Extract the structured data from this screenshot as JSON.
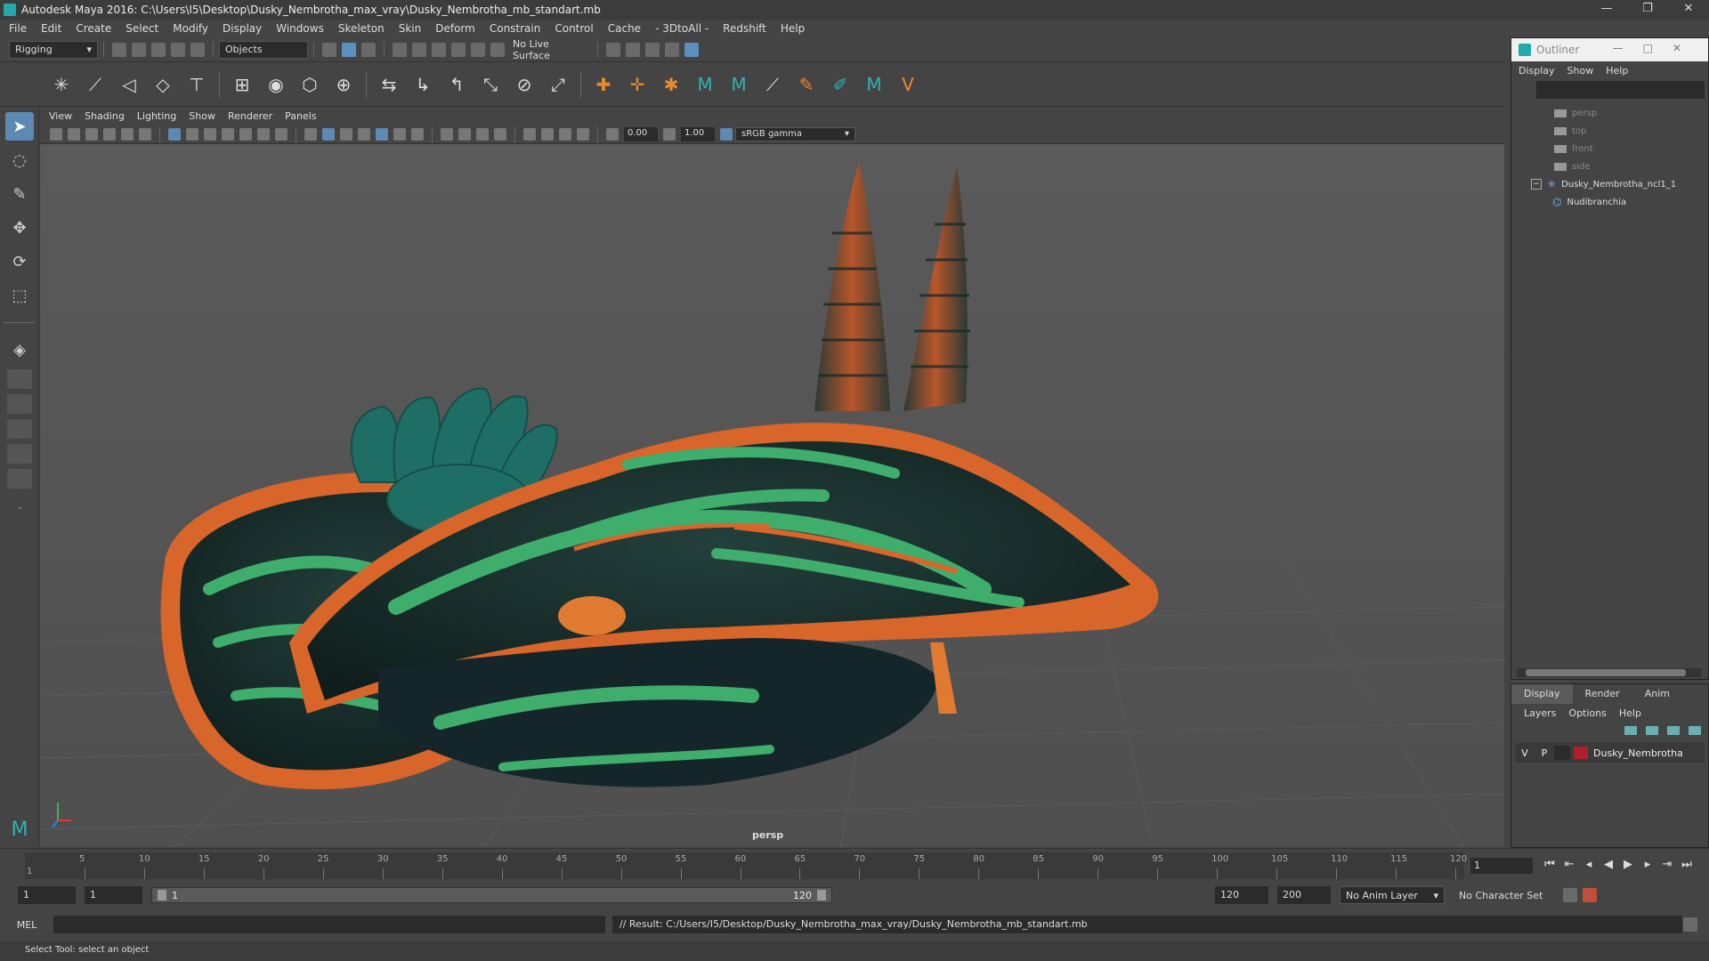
{
  "window": {
    "title": "Autodesk Maya 2016: C:\\Users\\I5\\Desktop\\Dusky_Nembrotha_max_vray\\Dusky_Nembrotha_mb_standart.mb",
    "minimize": "—",
    "restore": "❐",
    "close": "✕"
  },
  "menubar": [
    "File",
    "Edit",
    "Create",
    "Select",
    "Modify",
    "Display",
    "Windows",
    "Skeleton",
    "Skin",
    "Deform",
    "Constrain",
    "Control",
    "Cache",
    "- 3DtoAll -",
    "Redshift",
    "Help"
  ],
  "statusline": {
    "menuset": "Rigging",
    "select_mode": "Objects",
    "live_surface": "No Live Surface"
  },
  "viewport": {
    "menu": [
      "View",
      "Shading",
      "Lighting",
      "Show",
      "Renderer",
      "Panels"
    ],
    "exposure": "0.00",
    "gamma": "1.00",
    "color_space": "sRGB gamma",
    "camera_label": "persp"
  },
  "timeline": {
    "ticks": [
      "5",
      "10",
      "15",
      "20",
      "25",
      "30",
      "35",
      "40",
      "45",
      "50",
      "55",
      "60",
      "65",
      "70",
      "75",
      "80",
      "85",
      "90",
      "95",
      "100",
      "105",
      "110",
      "115",
      "120"
    ],
    "current_frame": "1",
    "start_label": "1"
  },
  "range": {
    "start": "1",
    "start2": "1",
    "slider_start": "1",
    "slider_end": "120",
    "end": "120",
    "end2": "200",
    "anim_layer": "No Anim Layer",
    "char_set": "No Character Set"
  },
  "cmdline": {
    "lang": "MEL",
    "result": "// Result: C:/Users/I5/Desktop/Dusky_Nembrotha_max_vray/Dusky_Nembrotha_mb_standart.mb"
  },
  "helpline": "Select Tool: select an object",
  "outliner": {
    "title": "Outliner",
    "menu": [
      "Display",
      "Show",
      "Help"
    ],
    "items": [
      "persp",
      "top",
      "front",
      "side"
    ],
    "group": "Dusky_Nembrotha_ncl1_1",
    "child": "Nudibranchia"
  },
  "layers": {
    "tabs": [
      "Display",
      "Render",
      "Anim"
    ],
    "menu": [
      "Layers",
      "Options",
      "Help"
    ],
    "row": {
      "v": "V",
      "p": "P",
      "name": "Dusky_Nembrotha",
      "color": "#b0202a"
    }
  },
  "colors": {
    "accent": "#5d8ab3",
    "body_dark": "#1a2e2c",
    "body_green": "#3fae6c",
    "body_orange": "#d8652a",
    "gills": "#1f6e66"
  }
}
